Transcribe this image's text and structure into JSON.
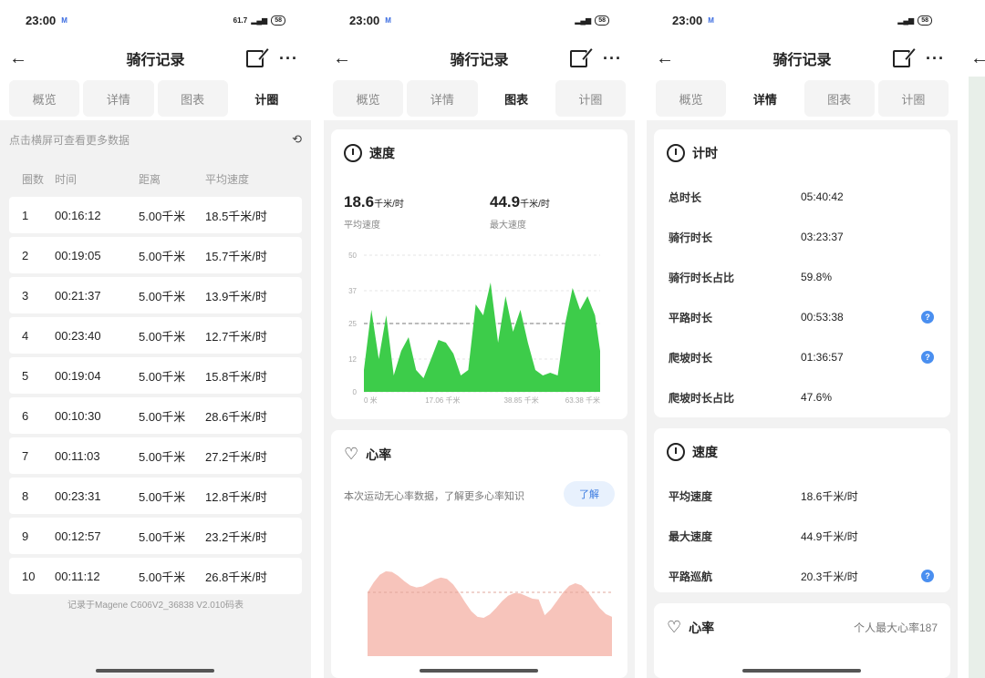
{
  "status": {
    "time": "23:00",
    "hd": "M",
    "net": "61.7",
    "battery": "58"
  },
  "header": {
    "title": "骑行记录"
  },
  "tabs": [
    "概览",
    "详情",
    "图表",
    "计圈"
  ],
  "laps": {
    "hint": "点击横屏可查看更多数据",
    "columns": [
      "圈数",
      "时间",
      "距离",
      "平均速度"
    ],
    "rows": [
      [
        "1",
        "00:16:12",
        "5.00千米",
        "18.5千米/时"
      ],
      [
        "2",
        "00:19:05",
        "5.00千米",
        "15.7千米/时"
      ],
      [
        "3",
        "00:21:37",
        "5.00千米",
        "13.9千米/时"
      ],
      [
        "4",
        "00:23:40",
        "5.00千米",
        "12.7千米/时"
      ],
      [
        "5",
        "00:19:04",
        "5.00千米",
        "15.8千米/时"
      ],
      [
        "6",
        "00:10:30",
        "5.00千米",
        "28.6千米/时"
      ],
      [
        "7",
        "00:11:03",
        "5.00千米",
        "27.2千米/时"
      ],
      [
        "8",
        "00:23:31",
        "5.00千米",
        "12.8千米/时"
      ],
      [
        "9",
        "00:12:57",
        "5.00千米",
        "23.2千米/时"
      ],
      [
        "10",
        "00:11:12",
        "5.00千米",
        "26.8千米/时"
      ]
    ],
    "footer": "记录于Magene C606V2_36838 V2.010码表"
  },
  "chart_panel": {
    "speed_title": "速度",
    "avg_value": "18.6",
    "avg_unit": "千米/时",
    "avg_label": "平均速度",
    "max_value": "44.9",
    "max_unit": "千米/时",
    "max_label": "最大速度",
    "hr_title": "心率",
    "hr_text": "本次运动无心率数据，了解更多心率知识",
    "hr_button": "了解",
    "colors": {
      "speed": "#3dcc4a",
      "hr": "#f7c4bb",
      "accent": "#3b7be0"
    }
  },
  "chart_data": {
    "type": "area",
    "yticks": [
      "0",
      "12",
      "25",
      "37",
      "50"
    ],
    "xticks": [
      "0 米",
      "17.06 千米",
      "38.85 千米",
      "63.38 千米"
    ],
    "ylim": [
      0,
      50
    ],
    "reference_line": 25,
    "x": [
      0,
      2,
      4,
      6,
      8,
      10,
      12,
      14,
      16,
      18,
      20,
      22,
      24,
      26,
      28,
      30,
      32,
      34,
      36,
      38,
      40,
      42,
      44,
      46,
      48,
      50,
      52,
      54,
      56,
      58,
      60,
      62,
      63.38
    ],
    "values": [
      8,
      30,
      12,
      28,
      6,
      15,
      20,
      8,
      5,
      12,
      19,
      18,
      14,
      6,
      8,
      32,
      28,
      40,
      18,
      35,
      22,
      30,
      18,
      8,
      6,
      7,
      6,
      25,
      38,
      30,
      35,
      28,
      15
    ]
  },
  "details": {
    "timing_title": "计时",
    "timing": [
      {
        "label": "总时长",
        "value": "05:40:42",
        "help": false
      },
      {
        "label": "骑行时长",
        "value": "03:23:37",
        "help": false
      },
      {
        "label": "骑行时长占比",
        "value": "59.8%",
        "help": false
      },
      {
        "label": "平路时长",
        "value": "00:53:38",
        "help": true
      },
      {
        "label": "爬坡时长",
        "value": "01:36:57",
        "help": true
      },
      {
        "label": "爬坡时长占比",
        "value": "47.6%",
        "help": false
      }
    ],
    "speed_title": "速度",
    "speed": [
      {
        "label": "平均速度",
        "value": "18.6千米/时",
        "help": false
      },
      {
        "label": "最大速度",
        "value": "44.9千米/时",
        "help": false
      },
      {
        "label": "平路巡航",
        "value": "20.3千米/时",
        "help": true
      }
    ],
    "hr_title": "心率",
    "hr_max": "个人最大心率187"
  }
}
